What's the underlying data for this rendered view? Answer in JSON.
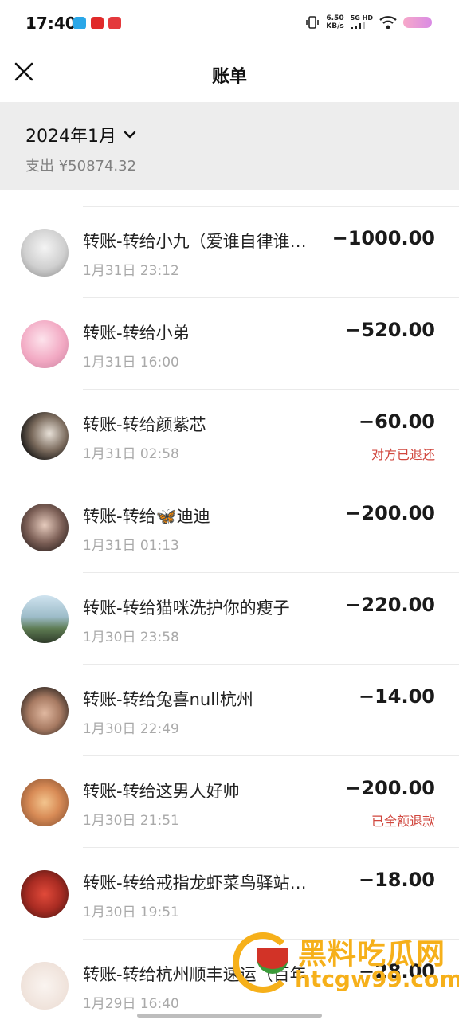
{
  "status_bar": {
    "time": "17:40",
    "net_speed_value": "6.50",
    "net_speed_unit": "KB/s",
    "network_tag": "5G HD"
  },
  "header": {
    "title": "账单"
  },
  "summary": {
    "month": "2024年1月",
    "expense": "支出 ¥50874.32"
  },
  "transactions": [
    {
      "title": "转账-转给小九（爱谁自律谁…",
      "time": "1月31日 23:12",
      "amount": "−1000.00",
      "status": ""
    },
    {
      "title": "转账-转给小弟",
      "time": "1月31日 16:00",
      "amount": "−520.00",
      "status": ""
    },
    {
      "title": "转账-转给颜紫芯",
      "time": "1月31日 02:58",
      "amount": "−60.00",
      "status": "对方已退还"
    },
    {
      "title": "转账-转给🦋迪迪",
      "time": "1月31日 01:13",
      "amount": "−200.00",
      "status": ""
    },
    {
      "title": "转账-转给猫咪洗护你的瘦子",
      "time": "1月30日 23:58",
      "amount": "−220.00",
      "status": ""
    },
    {
      "title": "转账-转给兔喜null杭州",
      "time": "1月30日 22:49",
      "amount": "−14.00",
      "status": ""
    },
    {
      "title": "转账-转给这男人好帅",
      "time": "1月30日 21:51",
      "amount": "−200.00",
      "status": "已全额退款"
    },
    {
      "title": "转账-转给戒指龙虾菜鸟驿站…",
      "time": "1月30日 19:51",
      "amount": "−18.00",
      "status": ""
    },
    {
      "title": "转账-转给杭州顺丰速运（百年",
      "time": "1月29日 16:40",
      "amount": "−28.00",
      "status": ""
    }
  ],
  "watermark": {
    "title": "黑料吃瓜网",
    "url": "htcgw99.com"
  },
  "colors": {
    "summary_bg": "#ededed",
    "status_red": "#d0463d",
    "watermark_orange": "#f6b01a"
  }
}
